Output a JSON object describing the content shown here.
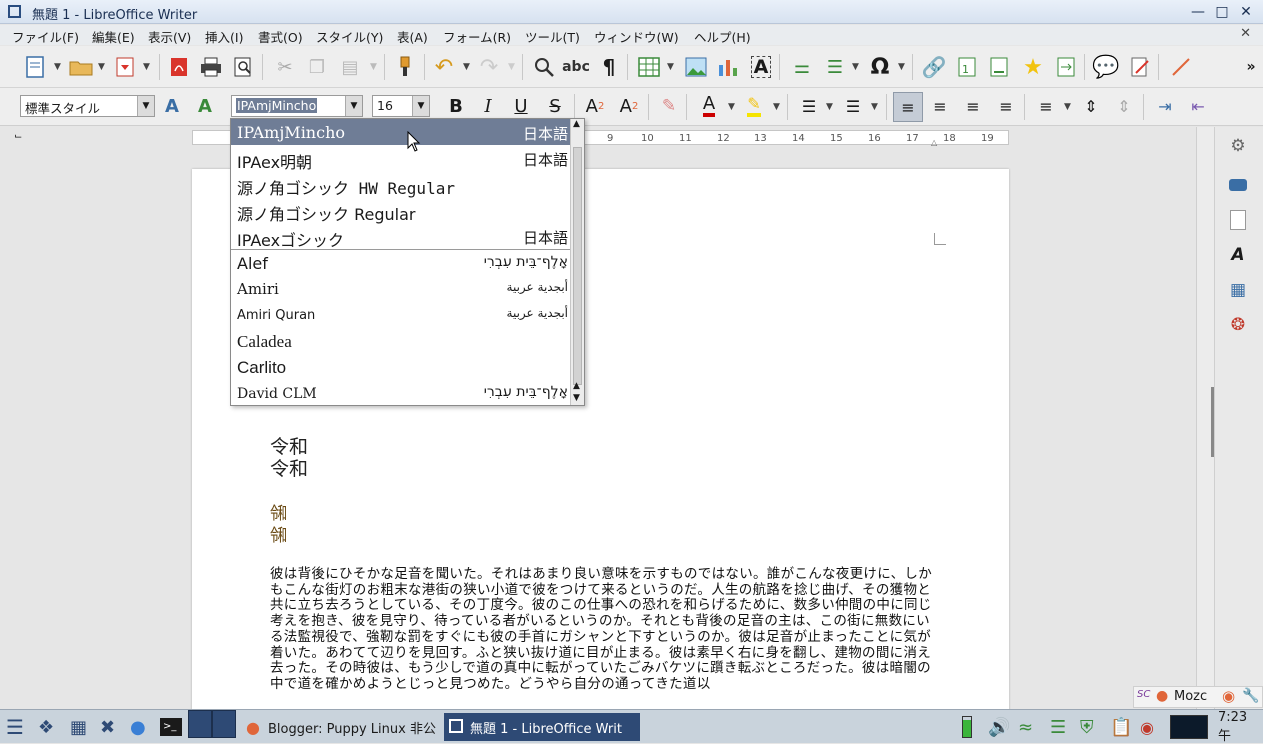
{
  "window": {
    "title": "無題 1 - LibreOffice Writer"
  },
  "menu": [
    "ファイル(F)",
    "編集(E)",
    "表示(V)",
    "挿入(I)",
    "書式(O)",
    "スタイル(Y)",
    "表(A)",
    "フォーム(R)",
    "ツール(T)",
    "ウィンドウ(W)",
    "ヘルプ(H)"
  ],
  "toolbar2": {
    "paragraph_style": "標準スタイル",
    "font_name": "IPAmjMincho",
    "font_size": "16"
  },
  "ruler_numbers": [
    "9",
    "10",
    "11",
    "12",
    "13",
    "14",
    "15",
    "16",
    "17",
    "18",
    "19"
  ],
  "font_list": [
    {
      "name": "IPAmjMincho",
      "sample": "日本語"
    },
    {
      "name": "IPAex明朝",
      "sample": "日本語"
    },
    {
      "name": "源ノ角ゴシック HW Regular",
      "sample": ""
    },
    {
      "name": "源ノ角ゴシック Regular",
      "sample": ""
    },
    {
      "name": "IPAexゴシック",
      "sample": "日本語"
    },
    {
      "name": "Alef",
      "sample": "אָלֶף־בֵּית עִבְרִי"
    },
    {
      "name": "Amiri",
      "sample": "أبجدية عربية"
    },
    {
      "name": "Amiri Quran",
      "sample": "أبجدية عربية"
    },
    {
      "name": "Caladea",
      "sample": ""
    },
    {
      "name": "Carlito",
      "sample": ""
    },
    {
      "name": "David CLM",
      "sample": "אָלֶף־בֵּית עִבְרִי"
    }
  ],
  "document": {
    "reiwa_lines": [
      "令和",
      "令和"
    ],
    "reiwa_variant_lines": [
      "㋿",
      "㋿"
    ],
    "body": "彼は背後にひそかな足音を聞いた。それはあまり良い意味を示すものではない。誰がこんな夜更けに、しかもこんな街灯のお粗末な港街の狭い小道で彼をつけて来るというのだ。人生の航路を捻じ曲げ、その獲物と共に立ち去ろうとしている、その丁度今。彼のこの仕事への恐れを和らげるために、数多い仲間の中に同じ考えを抱き、彼を見守り、待っている者がいるというのか。それとも背後の足音の主は、この街に無数にいる法監視役で、強靭な罰をすぐにも彼の手首にガシャンと下すというのか。彼は足音が止まったことに気が着いた。あわてて辺りを見回す。ふと狭い抜け道に目が止まる。彼は素早く右に身を翻し、建物の間に消え去った。その時彼は、もう少しで道の真中に転がっていたごみバケツに躓き転ぶところだった。彼は暗闇の中で道を確かめようとじっと見つめた。どうやら自分の通ってきた道以"
  },
  "ime": {
    "label": "Mozc"
  },
  "taskbar": {
    "tasks": [
      "Blogger: Puppy Linux 非公",
      "無題 1 - LibreOffice Writ"
    ],
    "clock": "7:23 午"
  }
}
